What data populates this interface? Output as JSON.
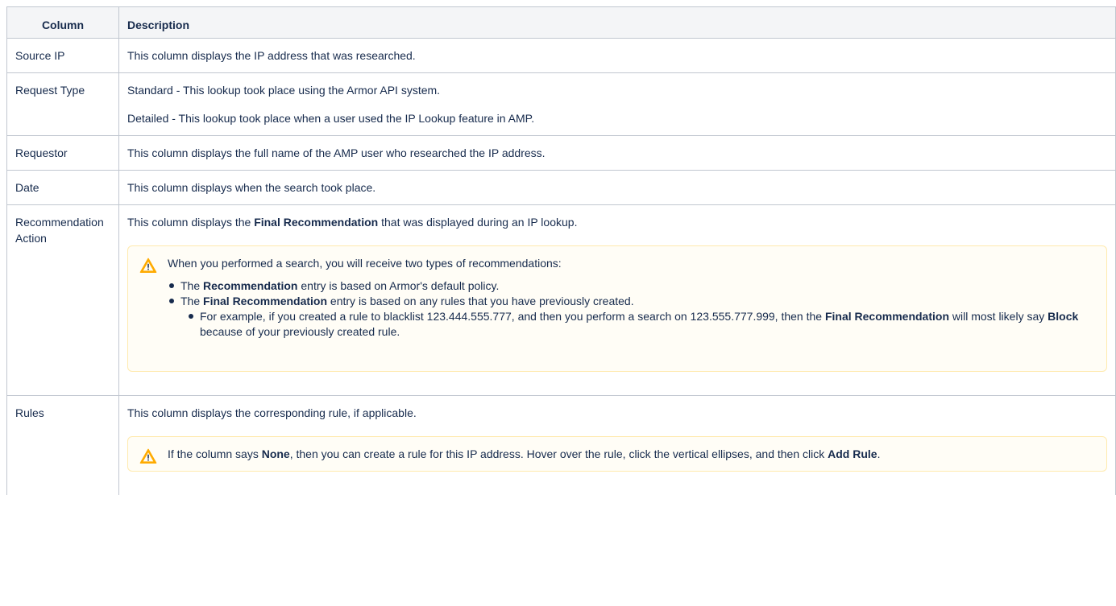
{
  "table": {
    "headers": [
      "Column",
      "Description"
    ],
    "rows": {
      "source_ip": {
        "label": "Source IP",
        "description": "This column displays the IP address that was researched."
      },
      "request_type": {
        "label": "Request Type",
        "standard": "Standard - This lookup took place using the Armor API system.",
        "detailed": "Detailed - This lookup took place when a user used the IP Lookup feature in AMP."
      },
      "requestor": {
        "label": "Requestor",
        "description": "This column displays the full name of the AMP user who researched the IP address."
      },
      "date": {
        "label": "Date",
        "description": "This column displays when the search took place."
      },
      "recommendation_action": {
        "label": "Recommendation Action",
        "intro_before": "This column displays the ",
        "intro_bold": "Final Recommendation",
        "intro_after": " that was displayed during an IP lookup.",
        "note": {
          "text": "When you performed a search, you will receive two types of recommendations:",
          "bullet1_before": "The ",
          "bullet1_bold": "Recommendation",
          "bullet1_after": " entry is based on Armor's default policy.",
          "bullet2_before": "The ",
          "bullet2_bold": "Final Recommendation",
          "bullet2_after": " entry is based on any rules that you have previously created.",
          "sub_before": "For example, if you created a rule to blacklist 123.444.555.777, and then you perform a search on 123.555.777.999, then the ",
          "sub_bold1": "Final Recommendation",
          "sub_mid": " will most likely say ",
          "sub_bold2": "Block",
          "sub_after": " because of your previously created rule."
        }
      },
      "rules": {
        "label": "Rules",
        "description": "This column displays the corresponding rule, if applicable.",
        "note": {
          "before": "If the column says ",
          "bold1": "None",
          "mid": ", then you can create a rule for this IP address. Hover over the rule, click the vertical ellipses, and then click ",
          "bold2": "Add Rule",
          "after": "."
        }
      }
    }
  },
  "colors": {
    "text": "#172b4d",
    "border": "#c1c7d0",
    "header_bg": "#f4f5f7",
    "note_bg": "#fffdf6",
    "note_border": "#ffeaae",
    "warning_icon": "#ffab00"
  },
  "icons": {
    "note": "warning-icon"
  }
}
